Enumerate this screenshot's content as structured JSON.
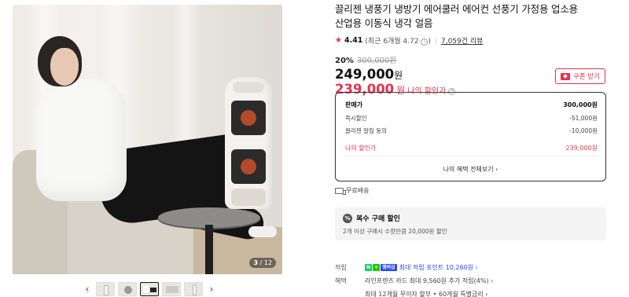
{
  "gallery": {
    "counter_current": "3",
    "counter_total": "/ 12",
    "prev_icon": "‹",
    "next_icon": "›"
  },
  "product": {
    "title_line1": "끌리젠 냉풍기 냉방기 에어쿨러 에어컨 선풍기 가정용 업소용",
    "title_line2": "산업용 이동식 냉각 얼음",
    "rating": "4.41",
    "rating_detail": "(최근 6개월 4.72",
    "rating_detail_end": ")",
    "rating_info_icon": "i",
    "reviews": "7,059건 리뷰",
    "discount_rate": "20%",
    "original_price": "300,000원",
    "price": "249,000",
    "price_unit": "원",
    "my_price": "239,000",
    "my_price_unit": "원",
    "my_price_label": "나의 할인가",
    "coupon_label": "쿠폰 받기"
  },
  "price_box": {
    "rows": [
      {
        "label": "판매가",
        "value": "300,000원"
      },
      {
        "label": "즉시할인",
        "value": "-51,000원"
      },
      {
        "label": "끌리젠 알림 동의",
        "value": "-10,000원"
      },
      {
        "label": "나의 할인가",
        "value": "239,000원"
      }
    ],
    "benefit_link": "나의 혜택 전체보기 ›"
  },
  "delivery": {
    "label": "무료배송"
  },
  "multi_discount": {
    "icon": "%",
    "title": "복수 구매 할인",
    "desc": "2개 이상 구매시 수량만큼 20,000원 할인"
  },
  "points": {
    "label": "적립",
    "badge_n": "N",
    "badge_plus": "+",
    "badge_member": "멤버십",
    "text": "최대 적립 포인트 10,260원 ›"
  },
  "benefits": {
    "label": "혜택",
    "line1": "라인프렌즈 카드 최대 9,560원 추가 적립(4%) ›",
    "line2": "최대 12개월 무이자 할부 • 60개월 특별금리 ›"
  }
}
